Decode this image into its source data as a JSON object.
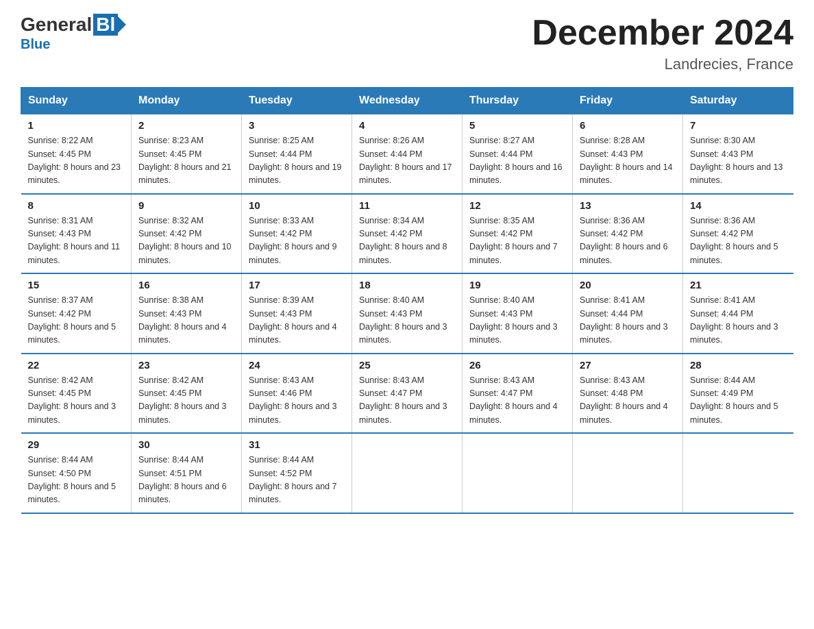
{
  "logo": {
    "general": "General",
    "blue": "Blue",
    "subtitle": "Blue"
  },
  "header": {
    "title": "December 2024",
    "location": "Landrecies, France"
  },
  "weekdays": [
    "Sunday",
    "Monday",
    "Tuesday",
    "Wednesday",
    "Thursday",
    "Friday",
    "Saturday"
  ],
  "weeks": [
    [
      {
        "day": "1",
        "sunrise": "8:22 AM",
        "sunset": "4:45 PM",
        "daylight": "8 hours and 23 minutes."
      },
      {
        "day": "2",
        "sunrise": "8:23 AM",
        "sunset": "4:45 PM",
        "daylight": "8 hours and 21 minutes."
      },
      {
        "day": "3",
        "sunrise": "8:25 AM",
        "sunset": "4:44 PM",
        "daylight": "8 hours and 19 minutes."
      },
      {
        "day": "4",
        "sunrise": "8:26 AM",
        "sunset": "4:44 PM",
        "daylight": "8 hours and 17 minutes."
      },
      {
        "day": "5",
        "sunrise": "8:27 AM",
        "sunset": "4:44 PM",
        "daylight": "8 hours and 16 minutes."
      },
      {
        "day": "6",
        "sunrise": "8:28 AM",
        "sunset": "4:43 PM",
        "daylight": "8 hours and 14 minutes."
      },
      {
        "day": "7",
        "sunrise": "8:30 AM",
        "sunset": "4:43 PM",
        "daylight": "8 hours and 13 minutes."
      }
    ],
    [
      {
        "day": "8",
        "sunrise": "8:31 AM",
        "sunset": "4:43 PM",
        "daylight": "8 hours and 11 minutes."
      },
      {
        "day": "9",
        "sunrise": "8:32 AM",
        "sunset": "4:42 PM",
        "daylight": "8 hours and 10 minutes."
      },
      {
        "day": "10",
        "sunrise": "8:33 AM",
        "sunset": "4:42 PM",
        "daylight": "8 hours and 9 minutes."
      },
      {
        "day": "11",
        "sunrise": "8:34 AM",
        "sunset": "4:42 PM",
        "daylight": "8 hours and 8 minutes."
      },
      {
        "day": "12",
        "sunrise": "8:35 AM",
        "sunset": "4:42 PM",
        "daylight": "8 hours and 7 minutes."
      },
      {
        "day": "13",
        "sunrise": "8:36 AM",
        "sunset": "4:42 PM",
        "daylight": "8 hours and 6 minutes."
      },
      {
        "day": "14",
        "sunrise": "8:36 AM",
        "sunset": "4:42 PM",
        "daylight": "8 hours and 5 minutes."
      }
    ],
    [
      {
        "day": "15",
        "sunrise": "8:37 AM",
        "sunset": "4:42 PM",
        "daylight": "8 hours and 5 minutes."
      },
      {
        "day": "16",
        "sunrise": "8:38 AM",
        "sunset": "4:43 PM",
        "daylight": "8 hours and 4 minutes."
      },
      {
        "day": "17",
        "sunrise": "8:39 AM",
        "sunset": "4:43 PM",
        "daylight": "8 hours and 4 minutes."
      },
      {
        "day": "18",
        "sunrise": "8:40 AM",
        "sunset": "4:43 PM",
        "daylight": "8 hours and 3 minutes."
      },
      {
        "day": "19",
        "sunrise": "8:40 AM",
        "sunset": "4:43 PM",
        "daylight": "8 hours and 3 minutes."
      },
      {
        "day": "20",
        "sunrise": "8:41 AM",
        "sunset": "4:44 PM",
        "daylight": "8 hours and 3 minutes."
      },
      {
        "day": "21",
        "sunrise": "8:41 AM",
        "sunset": "4:44 PM",
        "daylight": "8 hours and 3 minutes."
      }
    ],
    [
      {
        "day": "22",
        "sunrise": "8:42 AM",
        "sunset": "4:45 PM",
        "daylight": "8 hours and 3 minutes."
      },
      {
        "day": "23",
        "sunrise": "8:42 AM",
        "sunset": "4:45 PM",
        "daylight": "8 hours and 3 minutes."
      },
      {
        "day": "24",
        "sunrise": "8:43 AM",
        "sunset": "4:46 PM",
        "daylight": "8 hours and 3 minutes."
      },
      {
        "day": "25",
        "sunrise": "8:43 AM",
        "sunset": "4:47 PM",
        "daylight": "8 hours and 3 minutes."
      },
      {
        "day": "26",
        "sunrise": "8:43 AM",
        "sunset": "4:47 PM",
        "daylight": "8 hours and 4 minutes."
      },
      {
        "day": "27",
        "sunrise": "8:43 AM",
        "sunset": "4:48 PM",
        "daylight": "8 hours and 4 minutes."
      },
      {
        "day": "28",
        "sunrise": "8:44 AM",
        "sunset": "4:49 PM",
        "daylight": "8 hours and 5 minutes."
      }
    ],
    [
      {
        "day": "29",
        "sunrise": "8:44 AM",
        "sunset": "4:50 PM",
        "daylight": "8 hours and 5 minutes."
      },
      {
        "day": "30",
        "sunrise": "8:44 AM",
        "sunset": "4:51 PM",
        "daylight": "8 hours and 6 minutes."
      },
      {
        "day": "31",
        "sunrise": "8:44 AM",
        "sunset": "4:52 PM",
        "daylight": "8 hours and 7 minutes."
      },
      null,
      null,
      null,
      null
    ]
  ]
}
